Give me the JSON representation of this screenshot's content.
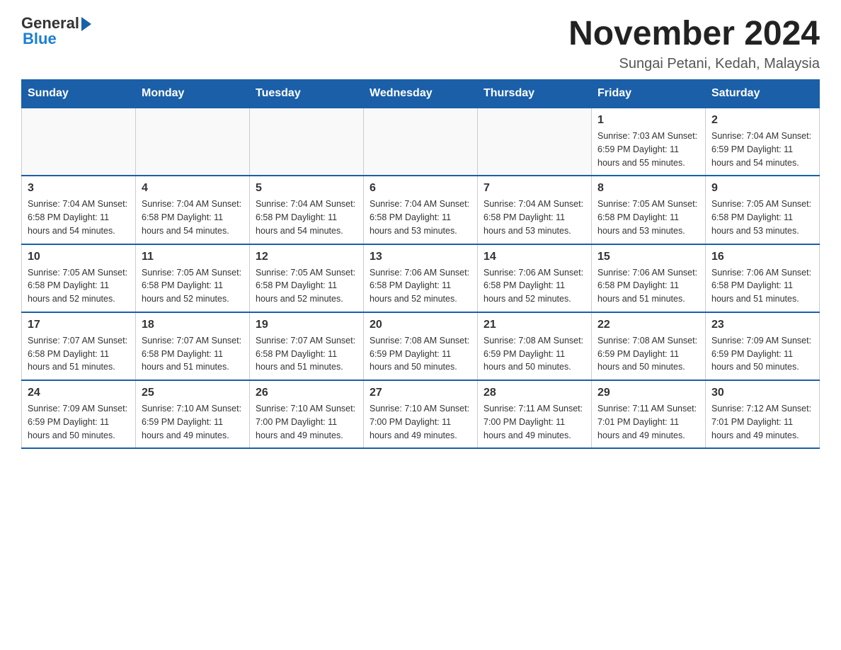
{
  "logo": {
    "general": "General",
    "blue": "Blue"
  },
  "title": {
    "month_year": "November 2024",
    "location": "Sungai Petani, Kedah, Malaysia"
  },
  "weekdays": [
    "Sunday",
    "Monday",
    "Tuesday",
    "Wednesday",
    "Thursday",
    "Friday",
    "Saturday"
  ],
  "weeks": [
    [
      {
        "day": "",
        "info": ""
      },
      {
        "day": "",
        "info": ""
      },
      {
        "day": "",
        "info": ""
      },
      {
        "day": "",
        "info": ""
      },
      {
        "day": "",
        "info": ""
      },
      {
        "day": "1",
        "info": "Sunrise: 7:03 AM\nSunset: 6:59 PM\nDaylight: 11 hours and 55 minutes."
      },
      {
        "day": "2",
        "info": "Sunrise: 7:04 AM\nSunset: 6:59 PM\nDaylight: 11 hours and 54 minutes."
      }
    ],
    [
      {
        "day": "3",
        "info": "Sunrise: 7:04 AM\nSunset: 6:58 PM\nDaylight: 11 hours and 54 minutes."
      },
      {
        "day": "4",
        "info": "Sunrise: 7:04 AM\nSunset: 6:58 PM\nDaylight: 11 hours and 54 minutes."
      },
      {
        "day": "5",
        "info": "Sunrise: 7:04 AM\nSunset: 6:58 PM\nDaylight: 11 hours and 54 minutes."
      },
      {
        "day": "6",
        "info": "Sunrise: 7:04 AM\nSunset: 6:58 PM\nDaylight: 11 hours and 53 minutes."
      },
      {
        "day": "7",
        "info": "Sunrise: 7:04 AM\nSunset: 6:58 PM\nDaylight: 11 hours and 53 minutes."
      },
      {
        "day": "8",
        "info": "Sunrise: 7:05 AM\nSunset: 6:58 PM\nDaylight: 11 hours and 53 minutes."
      },
      {
        "day": "9",
        "info": "Sunrise: 7:05 AM\nSunset: 6:58 PM\nDaylight: 11 hours and 53 minutes."
      }
    ],
    [
      {
        "day": "10",
        "info": "Sunrise: 7:05 AM\nSunset: 6:58 PM\nDaylight: 11 hours and 52 minutes."
      },
      {
        "day": "11",
        "info": "Sunrise: 7:05 AM\nSunset: 6:58 PM\nDaylight: 11 hours and 52 minutes."
      },
      {
        "day": "12",
        "info": "Sunrise: 7:05 AM\nSunset: 6:58 PM\nDaylight: 11 hours and 52 minutes."
      },
      {
        "day": "13",
        "info": "Sunrise: 7:06 AM\nSunset: 6:58 PM\nDaylight: 11 hours and 52 minutes."
      },
      {
        "day": "14",
        "info": "Sunrise: 7:06 AM\nSunset: 6:58 PM\nDaylight: 11 hours and 52 minutes."
      },
      {
        "day": "15",
        "info": "Sunrise: 7:06 AM\nSunset: 6:58 PM\nDaylight: 11 hours and 51 minutes."
      },
      {
        "day": "16",
        "info": "Sunrise: 7:06 AM\nSunset: 6:58 PM\nDaylight: 11 hours and 51 minutes."
      }
    ],
    [
      {
        "day": "17",
        "info": "Sunrise: 7:07 AM\nSunset: 6:58 PM\nDaylight: 11 hours and 51 minutes."
      },
      {
        "day": "18",
        "info": "Sunrise: 7:07 AM\nSunset: 6:58 PM\nDaylight: 11 hours and 51 minutes."
      },
      {
        "day": "19",
        "info": "Sunrise: 7:07 AM\nSunset: 6:58 PM\nDaylight: 11 hours and 51 minutes."
      },
      {
        "day": "20",
        "info": "Sunrise: 7:08 AM\nSunset: 6:59 PM\nDaylight: 11 hours and 50 minutes."
      },
      {
        "day": "21",
        "info": "Sunrise: 7:08 AM\nSunset: 6:59 PM\nDaylight: 11 hours and 50 minutes."
      },
      {
        "day": "22",
        "info": "Sunrise: 7:08 AM\nSunset: 6:59 PM\nDaylight: 11 hours and 50 minutes."
      },
      {
        "day": "23",
        "info": "Sunrise: 7:09 AM\nSunset: 6:59 PM\nDaylight: 11 hours and 50 minutes."
      }
    ],
    [
      {
        "day": "24",
        "info": "Sunrise: 7:09 AM\nSunset: 6:59 PM\nDaylight: 11 hours and 50 minutes."
      },
      {
        "day": "25",
        "info": "Sunrise: 7:10 AM\nSunset: 6:59 PM\nDaylight: 11 hours and 49 minutes."
      },
      {
        "day": "26",
        "info": "Sunrise: 7:10 AM\nSunset: 7:00 PM\nDaylight: 11 hours and 49 minutes."
      },
      {
        "day": "27",
        "info": "Sunrise: 7:10 AM\nSunset: 7:00 PM\nDaylight: 11 hours and 49 minutes."
      },
      {
        "day": "28",
        "info": "Sunrise: 7:11 AM\nSunset: 7:00 PM\nDaylight: 11 hours and 49 minutes."
      },
      {
        "day": "29",
        "info": "Sunrise: 7:11 AM\nSunset: 7:01 PM\nDaylight: 11 hours and 49 minutes."
      },
      {
        "day": "30",
        "info": "Sunrise: 7:12 AM\nSunset: 7:01 PM\nDaylight: 11 hours and 49 minutes."
      }
    ]
  ]
}
